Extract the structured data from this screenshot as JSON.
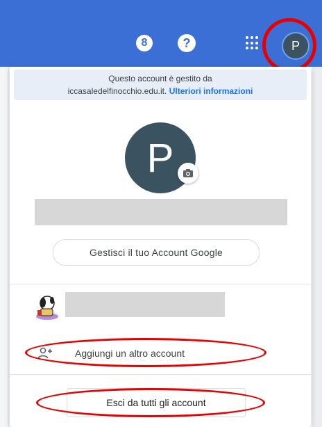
{
  "topbar": {
    "notification_count": "8",
    "help_symbol": "?",
    "apps_icon": "apps-grid-icon",
    "avatar_initial": "P",
    "bar_color": "#3c6fd6"
  },
  "panel": {
    "managed_notice_line1": "Questo account è gestito da",
    "managed_notice_domain": "iccasaledelfinocchio.edu.it.",
    "managed_notice_link": "Ulteriori informazioni",
    "avatar_initial": "P",
    "camera_icon": "camera-icon",
    "manage_account_button": "Gestisci il tuo Account Google",
    "add_account_label": "Aggiungi un altro account",
    "add_account_icon": "person-add-icon",
    "sign_out_all_button": "Esci da tutti gli account"
  },
  "annotations": {
    "highlight_color": "#e60000"
  }
}
